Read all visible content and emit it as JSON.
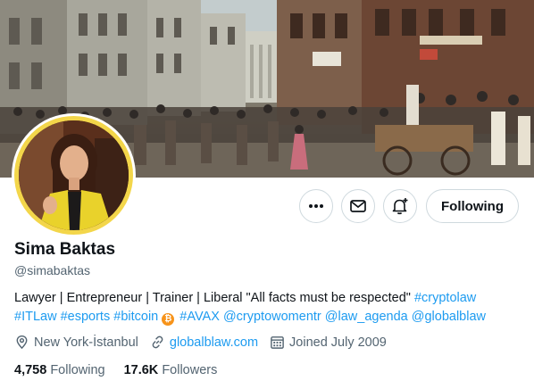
{
  "profile": {
    "name": "Sima Baktas",
    "handle": "@simabaktas"
  },
  "actions": {
    "more_icon": "more-horizontal-icon",
    "message_icon": "envelope-icon",
    "notify_icon": "bell-plus-icon",
    "following_label": "Following"
  },
  "bio": {
    "text": "Lawyer | Entrepreneur | Trainer | Liberal \"All facts must be respected\"",
    "hashtag_cryptolaw": "#cryptolaw",
    "hashtag_itlaw": "#ITLaw",
    "hashtag_esports": "#esports",
    "hashtag_bitcoin": "#bitcoin",
    "bitcoin_glyph": "₿",
    "hashtag_avax": "#AVAX",
    "mention_cryptowomentr": "@cryptowomentr",
    "mention_law_agenda": "@law_agenda",
    "mention_globalblaw": "@globalblaw"
  },
  "meta": {
    "location": "New York-İstanbul",
    "website": "globalblaw.com",
    "joined": "Joined July 2009"
  },
  "stats": {
    "following_count": "4,758",
    "following_label": "Following",
    "followers_count": "17.6K",
    "followers_label": "Followers"
  },
  "colors": {
    "link": "#1d9bf0",
    "avatar_ring": "#f3d64a",
    "secondary_text": "#536471",
    "bitcoin": "#f7931a"
  }
}
